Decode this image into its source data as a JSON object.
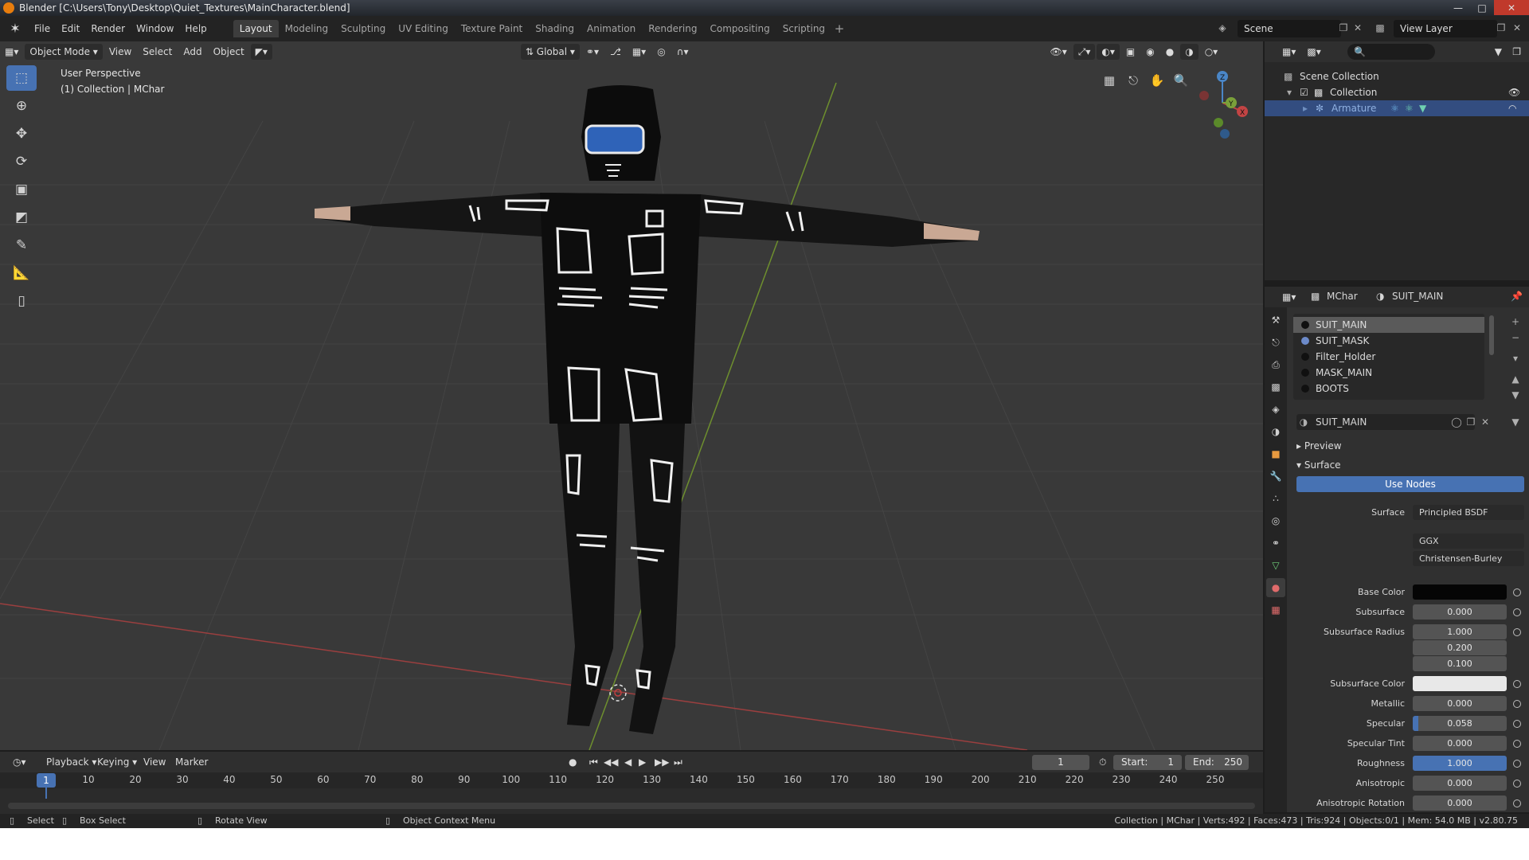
{
  "window": {
    "title": "Blender [C:\\Users\\Tony\\Desktop\\Quiet_Textures\\MainCharacter.blend]",
    "controls": [
      "minimize-icon",
      "maximize-icon",
      "close-icon"
    ]
  },
  "menu": [
    "File",
    "Edit",
    "Render",
    "Window",
    "Help"
  ],
  "workspaces": [
    {
      "label": "Layout",
      "active": true
    },
    {
      "label": "Modeling"
    },
    {
      "label": "Sculpting"
    },
    {
      "label": "UV Editing"
    },
    {
      "label": "Texture Paint"
    },
    {
      "label": "Shading"
    },
    {
      "label": "Animation"
    },
    {
      "label": "Rendering"
    },
    {
      "label": "Compositing"
    },
    {
      "label": "Scripting"
    }
  ],
  "scene": {
    "name": "Scene",
    "view_layer": "View Layer"
  },
  "viewport_header": {
    "mode": "Object Mode",
    "menus": [
      "View",
      "Select",
      "Add",
      "Object"
    ],
    "orientation": "Global"
  },
  "viewport_info": {
    "line1": "User Perspective",
    "line2": "(1) Collection | MChar"
  },
  "tools": [
    "select-box-icon",
    "cursor-icon",
    "move-icon",
    "rotate-icon",
    "scale-icon",
    "transform-icon",
    "annotate-icon",
    "measure-icon",
    "add-cube-icon"
  ],
  "gizmo_axes": {
    "x": "X",
    "y": "Y",
    "z": "Z"
  },
  "outliner": {
    "root": "Scene Collection",
    "collection": "Collection",
    "object": "Armature"
  },
  "properties": {
    "object": "MChar",
    "material": "SUIT_MAIN",
    "slots": [
      "SUIT_MAIN",
      "SUIT_MASK",
      "Filter_Holder",
      "MASK_MAIN",
      "BOOTS"
    ],
    "material_name": "SUIT_MAIN",
    "preview_label": "Preview",
    "surface_label": "Surface",
    "use_nodes": "Use Nodes",
    "surface_shader_label": "Surface",
    "surface_shader": "Principled BSDF",
    "distribution": "GGX",
    "subsurface_method": "Christensen-Burley",
    "fields": [
      {
        "label": "Base Color",
        "value": "",
        "color": "#050505"
      },
      {
        "label": "Subsurface",
        "value": "0.000"
      },
      {
        "label": "Subsurface Radius",
        "value": "1.000"
      },
      {
        "label": "",
        "value": "0.200"
      },
      {
        "label": "",
        "value": "0.100"
      },
      {
        "label": "Subsurface Color",
        "value": "",
        "color": "#e8e8e8"
      },
      {
        "label": "Metallic",
        "value": "0.000"
      },
      {
        "label": "Specular",
        "value": "0.058",
        "fill": 0.058
      },
      {
        "label": "Specular Tint",
        "value": "0.000"
      },
      {
        "label": "Roughness",
        "value": "1.000",
        "fill": 1.0
      },
      {
        "label": "Anisotropic",
        "value": "0.000"
      },
      {
        "label": "Anisotropic Rotation",
        "value": "0.000"
      }
    ]
  },
  "timeline": {
    "menus": [
      "Playback",
      "Keying",
      "View",
      "Marker"
    ],
    "current_frame": "1",
    "start_label": "Start:",
    "start": "1",
    "end_label": "End:",
    "end": "250",
    "ticks": [
      "1",
      "10",
      "20",
      "30",
      "40",
      "50",
      "60",
      "70",
      "80",
      "90",
      "100",
      "110",
      "120",
      "130",
      "140",
      "150",
      "160",
      "170",
      "180",
      "190",
      "200",
      "210",
      "220",
      "230",
      "240",
      "250"
    ]
  },
  "statusbar": {
    "select": "Select",
    "box_select": "Box Select",
    "rotate_view": "Rotate View",
    "context_menu": "Object Context Menu",
    "stats": "Collection | MChar | Verts:492 | Faces:473 | Tris:924 | Objects:0/1 | Mem: 54.0 MB | v2.80.75"
  },
  "colors": {
    "accent": "#4772b3",
    "x_axis": "#b34848",
    "y_axis": "#7aa03a",
    "z_axis": "#4a86c7"
  }
}
